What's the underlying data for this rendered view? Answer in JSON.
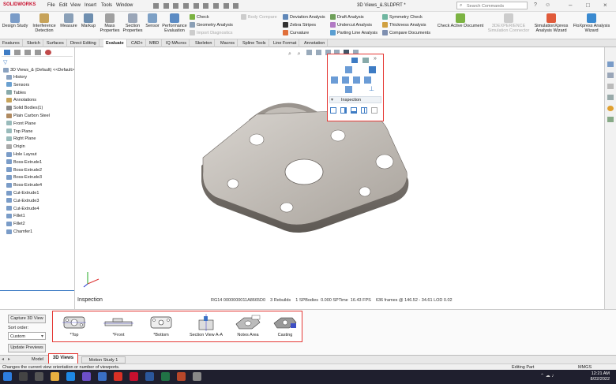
{
  "app": {
    "brand": "SOLIDWORKS",
    "window_title": "3D Views_&.SLDPRT *",
    "search_placeholder": "Search Commands"
  },
  "menu": [
    "File",
    "Edit",
    "View",
    "Insert",
    "Tools",
    "Window"
  ],
  "ribbon": {
    "big_buttons": [
      "Design Study",
      "Interference Detection",
      "Measure",
      "Markup",
      "Mass Properties",
      "Section Properties",
      "Sensor",
      "Performance Evaluation"
    ],
    "group1": [
      "Check",
      "Geometry Analysis",
      "Import Diagnostics"
    ],
    "group1b": [
      "Body Compare"
    ],
    "group2": [
      "Deviation Analysis",
      "Zebra Stripes",
      "Curvature"
    ],
    "group3": [
      "Draft Analysis",
      "Undercut Analysis",
      "Parting Line Analysis"
    ],
    "group4": [
      "Symmetry Check",
      "Thickness Analysis",
      "Compare Documents"
    ],
    "check_active": "Check Active Document",
    "right_buttons": [
      "3DEXPERIENCE Simulation Connector",
      "SimulationXpress Analysis Wizard",
      "FloXpress Analysis Wizard"
    ]
  },
  "tabs": [
    "Features",
    "Sketch",
    "Surfaces",
    "Direct Editing",
    "Evaluate",
    "CAD+",
    "MBD",
    "IQ MAcros",
    "Skeleton",
    "Macros",
    "Spline Tools",
    "Line Format",
    "Annotation"
  ],
  "active_tab": "Evaluate",
  "tree": {
    "root": "3D Views_& (Default) <<Default>",
    "items": [
      "History",
      "Sensors",
      "Tables",
      "Annotations",
      "Solid Bodies(1)",
      "Plain Carbon Steel",
      "Front Plane",
      "Top Plane",
      "Right Plane",
      "Origin",
      "Hole Layout",
      "Boss-Extrude1",
      "Boss-Extrude2",
      "Boss-Extrude3",
      "Boss-Extrude4",
      "Cut-Extrude1",
      "Cut-Extrude3",
      "Cut-Extrude4",
      "Fillet1",
      "Fillet2",
      "Chamfer1"
    ]
  },
  "popup": {
    "label": "Inspection"
  },
  "viewport": {
    "view_name": "Inspection",
    "stats": [
      "RG14 0000000011A8665D0",
      "3 Rebuilds",
      "1 SPBodies",
      "0.000 SPTime",
      "16.43 FPS",
      "636 frames @ 146.52 - 34.61 LOD 0.02"
    ]
  },
  "bottom_panel": {
    "capture_button": "Capture 3D View",
    "sort_label": "Sort order:",
    "sort_value": "Custom",
    "update_button": "Update Previews",
    "views": [
      "*Top",
      "*Front",
      "*Bottom",
      "Section View A-A",
      "Notes Area",
      "Casting"
    ]
  },
  "bottom_tabs": [
    "Model",
    "3D Views",
    "Motion Study 1"
  ],
  "active_bottom_tab": "3D Views",
  "status": {
    "left": "Changes the current view orientation or number of viewports.",
    "mode": "Editing Part",
    "units": "MMGS"
  },
  "taskbar": {
    "time": "12:21 AM",
    "date": "8/22/2022"
  }
}
